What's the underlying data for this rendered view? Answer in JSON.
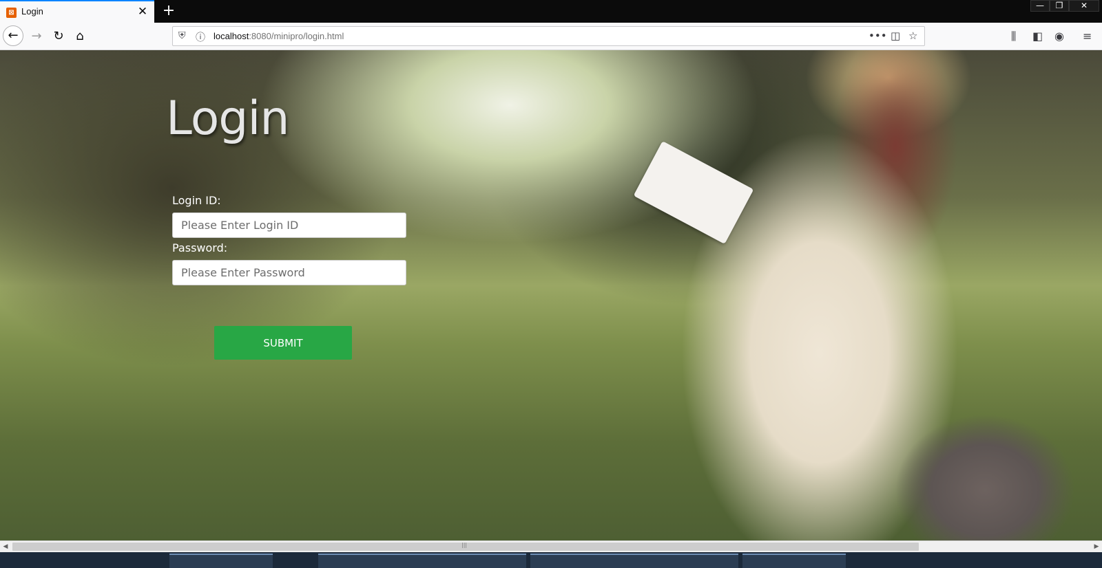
{
  "browser": {
    "tab_title": "Login",
    "tab_close": "✕",
    "new_tab": "+",
    "url_host": "localhost",
    "url_path": ":8080/minipro/login.html",
    "window_controls": [
      "—",
      "❐",
      "✕"
    ],
    "icons": {
      "favicon": "web-favicon-icon",
      "back": "back-arrow-icon",
      "forward": "forward-arrow-icon",
      "reload": "reload-icon",
      "home": "home-icon",
      "shield": "shield-icon",
      "info": "info-icon",
      "more": "more-icon",
      "pocket": "pocket-icon",
      "bookmark": "star-icon",
      "library": "library-icon",
      "sidebar": "sidebar-icon",
      "account": "account-icon",
      "menu": "menu-icon"
    }
  },
  "page": {
    "title": "Login",
    "login_id_label": "Login ID:",
    "login_id_placeholder": "Please Enter Login ID",
    "password_label": "Password:",
    "password_placeholder": "Please Enter Password",
    "submit_label": "SUBMIT",
    "colors": {
      "submit_bg": "#28a745",
      "title_text": "#e6e6e6",
      "label_text": "#ffffff"
    }
  }
}
